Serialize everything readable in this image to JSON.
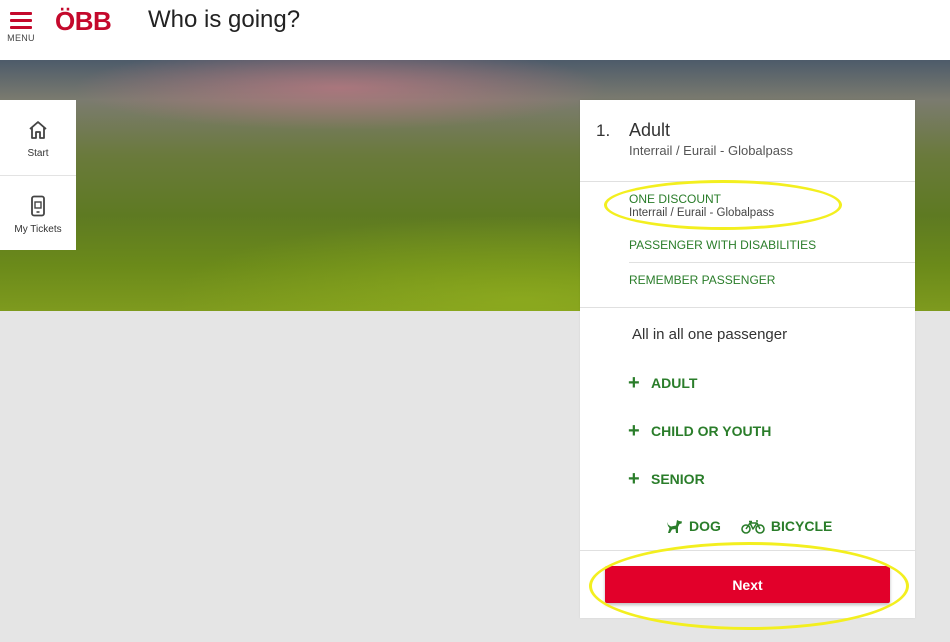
{
  "header": {
    "menu_label": "MENU",
    "logo_text": "ÖBB",
    "title": "Who is going?"
  },
  "side_nav": {
    "items": [
      {
        "label": "Start",
        "icon": "home-icon"
      },
      {
        "label": "My Tickets",
        "icon": "phone-ticket-icon"
      }
    ]
  },
  "passenger": {
    "number": "1.",
    "type": "Adult",
    "subtitle": "Interrail / Eurail - Globalpass",
    "discount_label": "ONE DISCOUNT",
    "discount_value": "Interrail / Eurail - Globalpass",
    "disabilities_label": "PASSENGER WITH DISABILITIES",
    "remember_label": "REMEMBER PASSENGER"
  },
  "summary": "All in all one passenger",
  "add_buttons": {
    "adult": "ADULT",
    "child": "CHILD OR YOUTH",
    "senior": "SENIOR"
  },
  "extras": {
    "dog": "DOG",
    "bicycle": "BICYCLE"
  },
  "next_button": "Next",
  "colors": {
    "brand_red": "#c4092c",
    "button_red": "#e2002a",
    "action_green": "#2a7d2a",
    "highlight_yellow": "#f3ef1f"
  }
}
